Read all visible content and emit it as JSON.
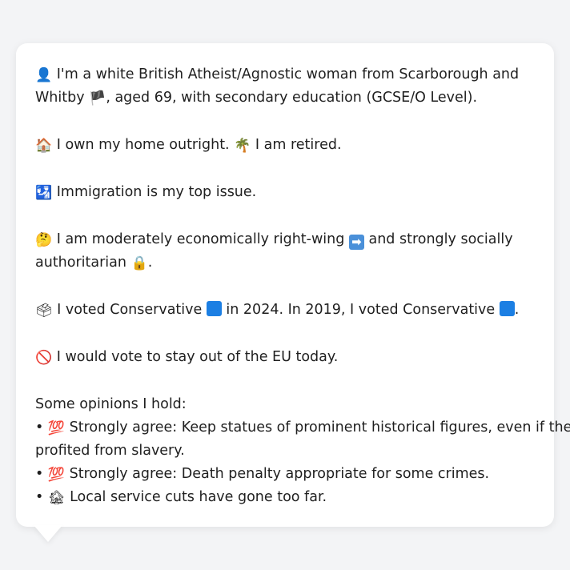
{
  "profile": {
    "p1": {
      "icon": "person-silhouette-icon",
      "icon_glyph": "👤",
      "text_a": " I'm a white British Atheist/Agnostic woman from Scarborough and",
      "text_b": "Whitby ",
      "flag_icon": "england-flag-icon",
      "flag_glyph": "🏴",
      "text_c": ", aged 69, with secondary education (GCSE/O Level)."
    },
    "p2": {
      "icon1": "house-icon",
      "icon1_glyph": "🏠",
      "text_a": " I own my home outright. ",
      "icon2": "palm-tree-icon",
      "icon2_glyph": "🌴",
      "text_b": " I am retired."
    },
    "p3": {
      "icon": "passport-control-icon",
      "icon_glyph": "🛂",
      "text": " Immigration is my top issue."
    },
    "p4": {
      "icon1": "thinking-face-icon",
      "icon1_glyph": "🤔",
      "text_a": " I am moderately economically right-wing ",
      "icon2": "right-arrow-icon",
      "icon2_glyph": "➡",
      "text_b": " and strongly socially",
      "text_c": "authoritarian ",
      "icon3": "lock-icon",
      "icon3_glyph": "🔒",
      "text_d": "."
    },
    "p5": {
      "icon": "ballot-box-icon",
      "icon_glyph": "🗳",
      "text_a": " I voted Conservative ",
      "party_color": "#1c7fe3",
      "text_b": " in 2024. In 2019, I voted Conservative ",
      "text_c": "."
    },
    "p6": {
      "icon": "prohibited-icon",
      "icon_glyph": "🚫",
      "text": " I would vote to stay out of the EU today."
    },
    "opinions": {
      "heading": "Some opinions I hold:",
      "bullet": "•",
      "items": [
        {
          "icon": "hundred-points-icon",
          "icon_glyph": "💯",
          "line1": " Strongly agree: Keep statues of prominent historical figures, even if they",
          "line2": "profited from slavery."
        },
        {
          "icon": "hundred-points-icon",
          "icon_glyph": "💯",
          "line1": " Strongly agree: Death penalty appropriate for some crimes."
        },
        {
          "icon": "derelict-house-icon",
          "icon_glyph": "🏚",
          "line1": " Local service cuts have gone too far."
        }
      ]
    }
  }
}
